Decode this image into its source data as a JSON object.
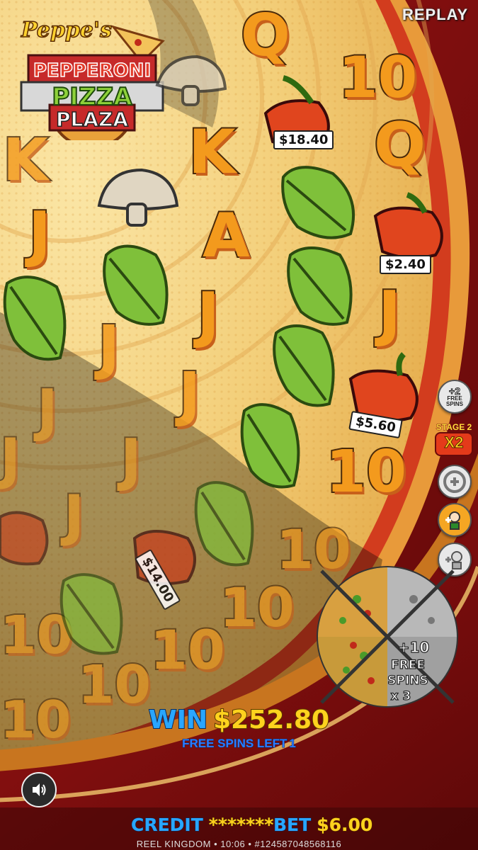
{
  "header": {
    "replay_label": "REPLAY",
    "logo": {
      "line1": "Peppe's",
      "line2": "PEPPERONI",
      "line3": "PIZZA",
      "line4": "PLAZA"
    }
  },
  "reels": {
    "symbols": {
      "q1": "Q",
      "ten1": "10",
      "k1": "K",
      "q2": "Q",
      "k2": "K",
      "j1": "J",
      "a1": "A",
      "j2": "J",
      "j3": "J",
      "j4": "J",
      "j5": "J",
      "ten2": "10",
      "j6": "J",
      "j7": "J",
      "j8": "J",
      "j9": "J",
      "ten3": "10",
      "ten4": "10",
      "ten5": "10",
      "ten6": "10",
      "ten7": "10",
      "ten8": "10",
      "ten9": "10"
    },
    "pepper_values": [
      "$18.40",
      "$2.40",
      "$5.60",
      "$14.00"
    ]
  },
  "side_panel": {
    "plus_free_spins": "+2 FREE SPINS",
    "plus_free_spins_num": "+2",
    "plus_free_spins_text1": "FREE",
    "plus_free_spins_text2": "SPINS",
    "stage_label": "STAGE 2",
    "stage_multiplier": "X2"
  },
  "wheel": {
    "line1": "+10",
    "line2": "FREE",
    "line3": "SPINS",
    "line4": "x 3"
  },
  "status": {
    "win_label": "WIN",
    "win_amount": "$252.80",
    "free_spins_left_label": "FREE SPINS LEFT",
    "free_spins_left_value": "1"
  },
  "bottom": {
    "credit_label": "CREDIT",
    "credit_value": "*******",
    "bet_label": "BET",
    "bet_value": "$6.00",
    "footer_text": "REEL KINGDOM • 10:06 • #124587048568116"
  },
  "colors": {
    "accent_blue": "#29a6ff",
    "accent_yellow": "#ffd21e",
    "crust_red": "#b01a1a",
    "background_cheese": "#f4d27a"
  }
}
